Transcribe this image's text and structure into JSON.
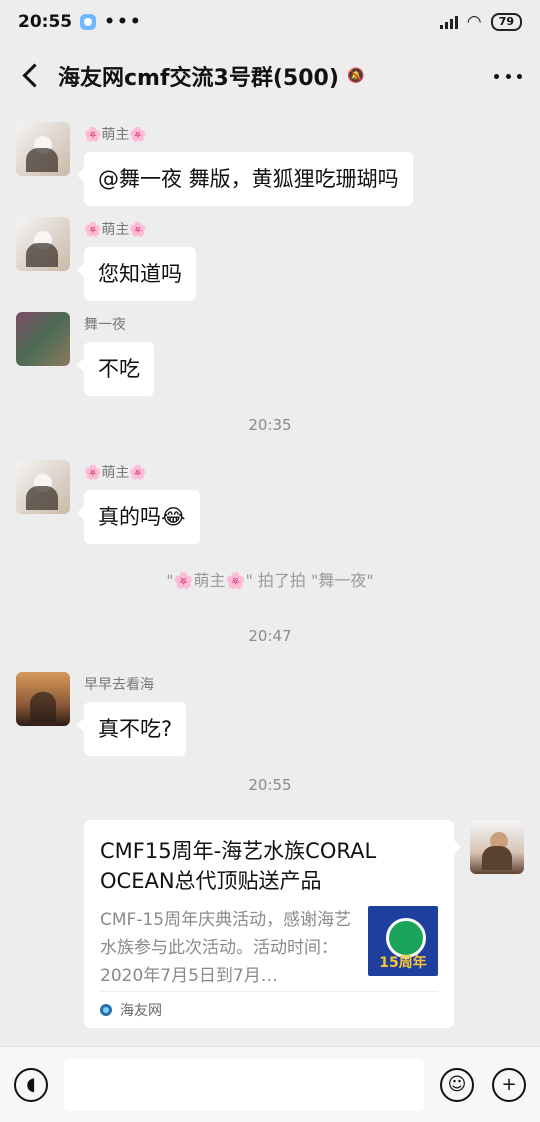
{
  "status_bar": {
    "time": "20:55",
    "dots": "•••",
    "battery": "79"
  },
  "header": {
    "title": "海友网cmf交流3号群(500)"
  },
  "messages": [
    {
      "nickname": "🌸萌主🌸",
      "text": "@舞一夜  舞版，黄狐狸吃珊瑚吗"
    },
    {
      "nickname": "🌸萌主🌸",
      "text": "您知道吗"
    },
    {
      "nickname": "舞一夜",
      "text": "不吃"
    },
    {
      "nickname": "🌸萌主🌸",
      "text": "真的吗😂"
    },
    {
      "nickname": "早早去看海",
      "text": "真不吃?"
    }
  ],
  "timestamps": [
    "20:35",
    "20:47",
    "20:55"
  ],
  "system_message": "\"🌸萌主🌸\" 拍了拍 \"舞一夜\"",
  "shared_card": {
    "title": "CMF15周年-海艺水族CORAL OCEAN总代顶贴送产品",
    "description": "CMF-15周年庆典活动，感谢海艺水族参与此次活动。活动时间：2020年7月5日到7月…",
    "thumbnail_text": "15周年",
    "source": "海友网"
  },
  "input": {
    "placeholder": ""
  },
  "icons": {
    "back": "back-icon",
    "mute": "mute-icon",
    "more": "more-icon",
    "voice": "voice-icon",
    "emoji": "emoji-icon",
    "add": "add-icon"
  }
}
